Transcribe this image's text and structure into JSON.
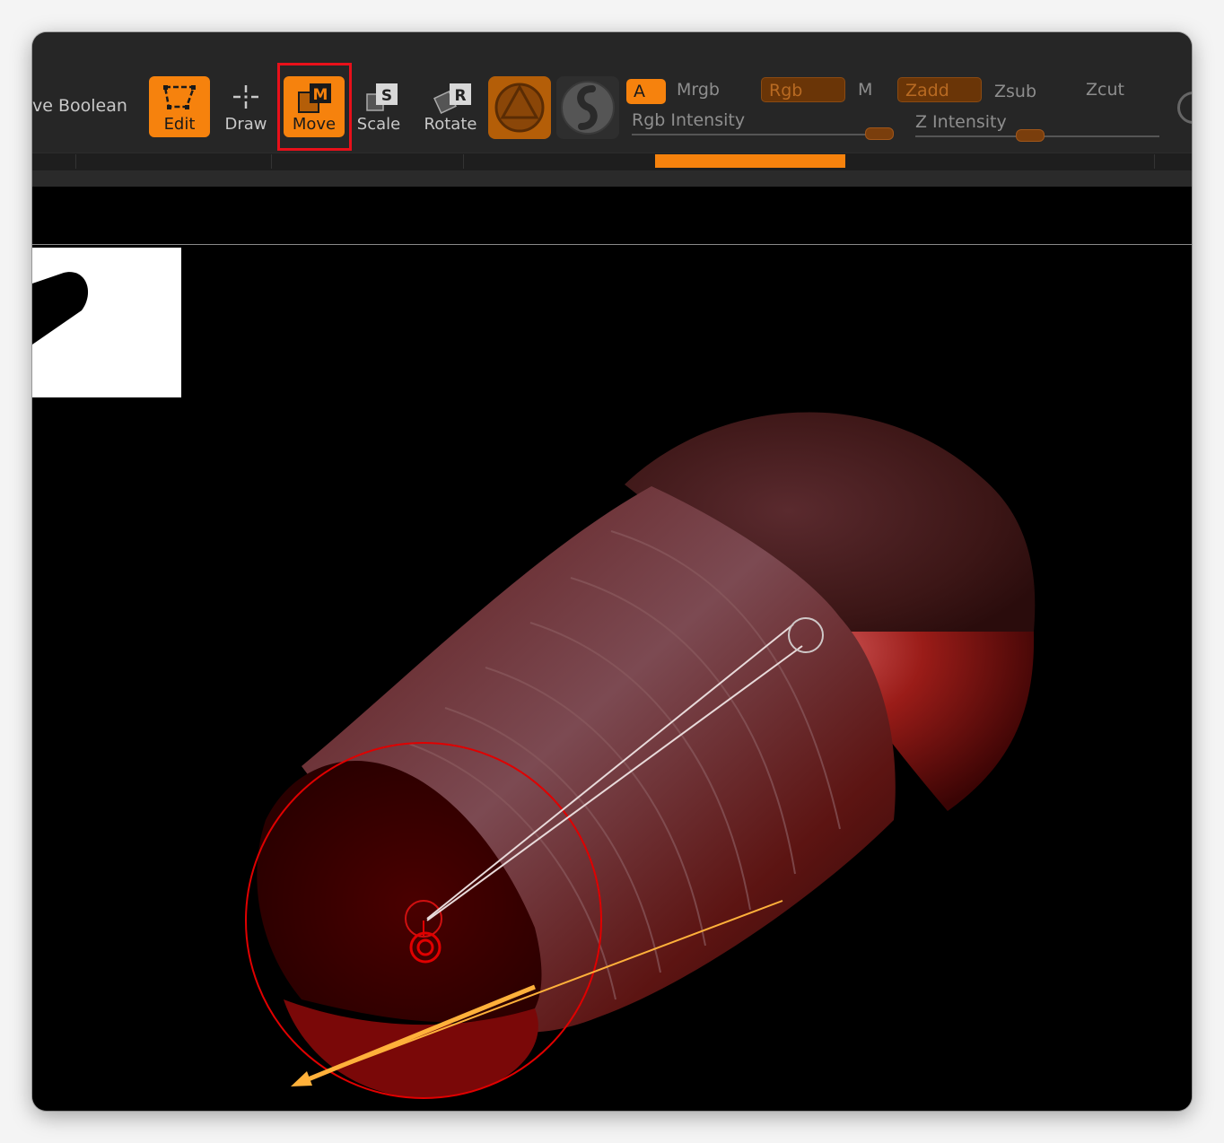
{
  "toolbar": {
    "boolean_label": "ve Boolean",
    "tools": [
      {
        "label": "Edit",
        "key": "",
        "active": true,
        "icon": "edit-icon"
      },
      {
        "label": "Draw",
        "key": "",
        "active": false,
        "icon": "draw-icon"
      },
      {
        "label": "Move",
        "key": "M",
        "active": true,
        "icon": "move-icon"
      },
      {
        "label": "Scale",
        "key": "S",
        "active": false,
        "icon": "scale-icon"
      },
      {
        "label": "Rotate",
        "key": "R",
        "active": false,
        "icon": "rotate-icon"
      }
    ],
    "material_icon": "material-sphere-icon",
    "stroke_icon": "stroke-icon",
    "color": {
      "a_label": "A",
      "mrgb_label": "Mrgb",
      "rgb_label": "Rgb",
      "m_label": "M",
      "rgb_intensity_label": "Rgb Intensity"
    },
    "depth": {
      "zadd_label": "Zadd",
      "zsub_label": "Zsub",
      "zcut_label": "Zcut",
      "z_intensity_label": "Z Intensity"
    }
  },
  "colors": {
    "accent": "#f6820d",
    "highlight_box": "#e8101a",
    "gizmo_circle": "#e00000",
    "direction_arrow": "#ffb13b",
    "model_red": "#7a1412"
  }
}
